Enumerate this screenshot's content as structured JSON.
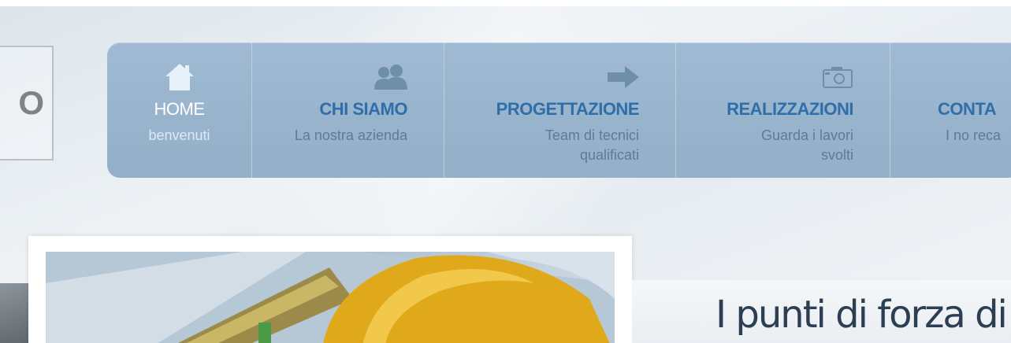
{
  "logo": {
    "text": "O"
  },
  "nav": {
    "items": [
      {
        "title": "HOME",
        "subtitle": "benvenuti",
        "icon": "home-icon"
      },
      {
        "title": "CHI SIAMO",
        "subtitle": "La nostra azienda",
        "icon": "people-icon"
      },
      {
        "title": "PROGETTAZIONE",
        "subtitle": "Team di tecnici qualificati",
        "icon": "arrow-right-icon"
      },
      {
        "title": "REALIZZAZIONI",
        "subtitle": "Guarda i lavori svolti",
        "icon": "camera-icon"
      },
      {
        "title": "CONTA",
        "subtitle": "I no reca",
        "icon": ""
      }
    ]
  },
  "hero": {
    "tagline": "I punti di forza di"
  },
  "colors": {
    "nav_bg": "#9fbad2",
    "accent": "#2f6ea9",
    "tagline": "#2c3e52"
  }
}
